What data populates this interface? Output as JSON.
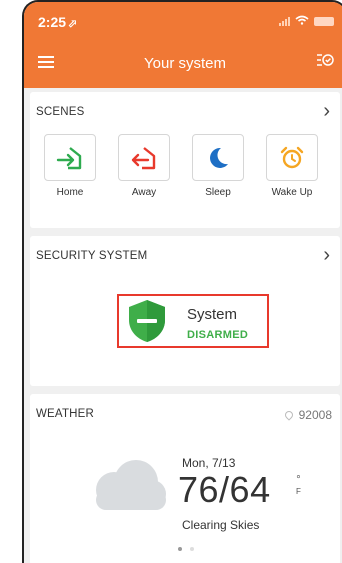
{
  "status_bar": {
    "time": "2:25",
    "location_glyph": "⬀"
  },
  "header": {
    "title": "Your system"
  },
  "scenes": {
    "heading": "SCENES",
    "items": [
      {
        "label": "Home",
        "icon": "home-arrow-in-icon",
        "color": "#2eab4f"
      },
      {
        "label": "Away",
        "icon": "home-arrow-out-icon",
        "color": "#e8392c"
      },
      {
        "label": "Sleep",
        "icon": "moon-icon",
        "color": "#1e6fc5"
      },
      {
        "label": "Wake Up",
        "icon": "alarm-clock-icon",
        "color": "#f5a623"
      }
    ]
  },
  "security": {
    "heading": "SECURITY SYSTEM",
    "label": "System",
    "state": "DISARMED",
    "state_color": "#3fae49"
  },
  "weather": {
    "heading": "WEATHER",
    "zip": "92008",
    "date": "Mon, 7/13",
    "temps": "76/64",
    "unit_deg": "°",
    "unit_f": "F",
    "condition": "Clearing Skies"
  },
  "colors": {
    "accent": "#f07835",
    "highlight_border": "#e8392c"
  }
}
